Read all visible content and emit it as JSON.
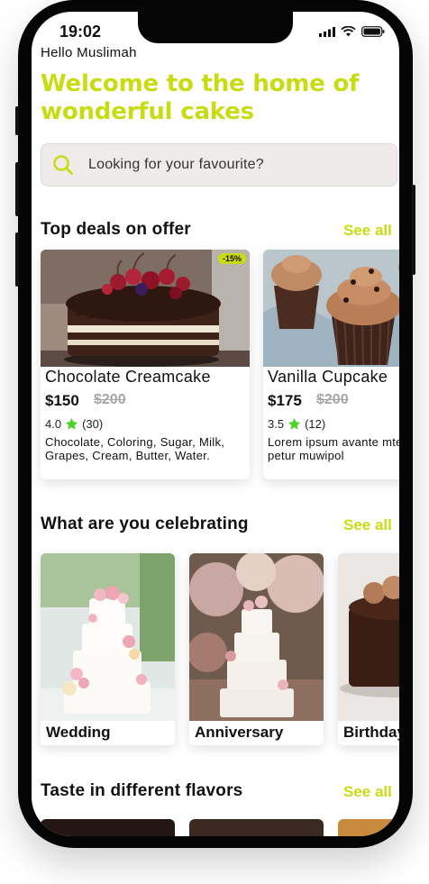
{
  "status": {
    "time": "19:02"
  },
  "greeting": "Hello Muslimah",
  "headline": "Welcome to the home of wonderful cakes",
  "search": {
    "placeholder": "Looking for your favourite?"
  },
  "sections": {
    "deals": {
      "title": "Top deals on offer",
      "see_all": "See all"
    },
    "celebrating": {
      "title": "What are you celebrating",
      "see_all": "See all"
    },
    "flavors": {
      "title": "Taste in different flavors",
      "see_all": "See all"
    }
  },
  "deals": [
    {
      "badge": "-15%",
      "name": "Chocolate Creamcake",
      "price": "$150",
      "old_price": "$200",
      "rating": "4.0",
      "reviews": "(30)",
      "description": "Chocolate, Coloring, Sugar, Milk, Grapes, Cream, Butter, Water."
    },
    {
      "name": "Vanilla Cupcake",
      "price": "$175",
      "old_price": "$200",
      "rating": "3.5",
      "reviews": "(12)",
      "description": "Lorem ipsum avante mtewrm viscan petur muwipol"
    }
  ],
  "occasions": [
    {
      "label": "Wedding"
    },
    {
      "label": "Anniversary"
    },
    {
      "label": "Birthday"
    }
  ],
  "colors": {
    "accent": "#c9dc12",
    "star": "#4cd32a",
    "text": "#111111"
  }
}
